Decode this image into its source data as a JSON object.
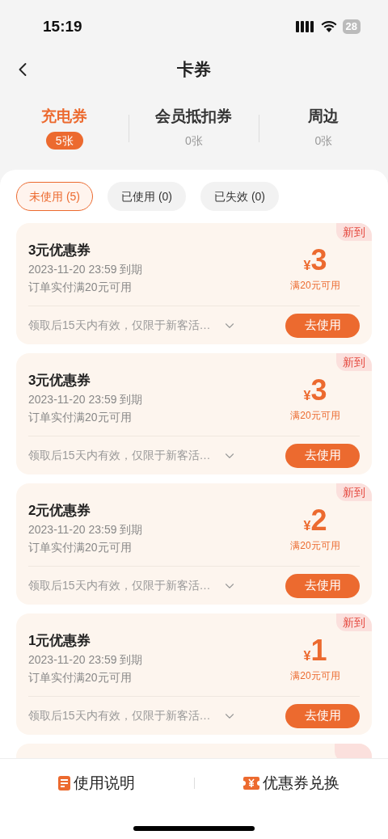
{
  "status_bar": {
    "time": "15:19",
    "battery": "28"
  },
  "header": {
    "title": "卡券"
  },
  "categories": [
    {
      "label": "充电券",
      "count": "5张",
      "selected": true
    },
    {
      "label": "会员抵扣券",
      "count": "0张",
      "selected": false
    },
    {
      "label": "周边",
      "count": "0张",
      "selected": false
    }
  ],
  "filters": [
    {
      "label": "未使用 (5)",
      "selected": true
    },
    {
      "label": "已使用 (0)",
      "selected": false
    },
    {
      "label": "已失效 (0)",
      "selected": false
    }
  ],
  "coupons": [
    {
      "title": "3元优惠券",
      "expiry": "2023-11-20 23:59 到期",
      "condition": "订单实付满20元可用",
      "badge": "新到",
      "currency": "¥",
      "amount": "3",
      "threshold": "满20元可用",
      "note": "领取后15天内有效，仅限于新客活…",
      "action": "去使用"
    },
    {
      "title": "3元优惠券",
      "expiry": "2023-11-20 23:59 到期",
      "condition": "订单实付满20元可用",
      "badge": "新到",
      "currency": "¥",
      "amount": "3",
      "threshold": "满20元可用",
      "note": "领取后15天内有效，仅限于新客活…",
      "action": "去使用"
    },
    {
      "title": "2元优惠券",
      "expiry": "2023-11-20 23:59 到期",
      "condition": "订单实付满20元可用",
      "badge": "新到",
      "currency": "¥",
      "amount": "2",
      "threshold": "满20元可用",
      "note": "领取后15天内有效，仅限于新客活…",
      "action": "去使用"
    },
    {
      "title": "1元优惠券",
      "expiry": "2023-11-20 23:59 到期",
      "condition": "订单实付满20元可用",
      "badge": "新到",
      "currency": "¥",
      "amount": "1",
      "threshold": "满20元可用",
      "note": "领取后15天内有效，仅限于新客活…",
      "action": "去使用"
    }
  ],
  "more_below": true,
  "bottom_bar": [
    {
      "kind": "guide",
      "label": "使用说明"
    },
    {
      "kind": "exchange",
      "label": "优惠券兑换"
    }
  ]
}
